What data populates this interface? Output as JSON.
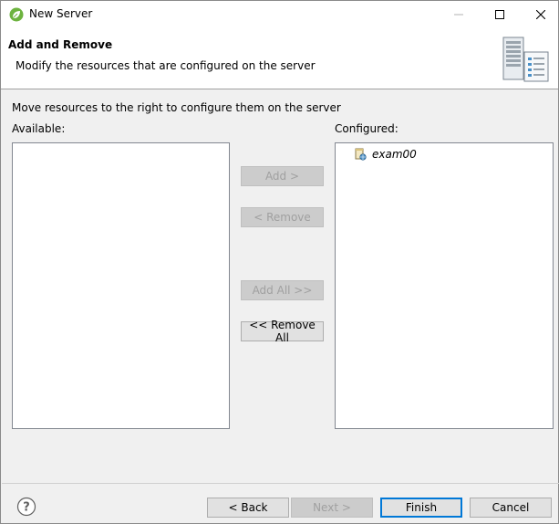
{
  "window": {
    "title": "New Server",
    "icon": "spring-leaf-icon"
  },
  "header": {
    "title": "Add and Remove",
    "description": "Modify the resources that are configured on the server",
    "graphic": "server-graphic-icon"
  },
  "main": {
    "instructions": "Move resources to the right to configure them on the server",
    "available_label": "Available:",
    "configured_label": "Configured:",
    "available_items": [],
    "configured_items": [
      {
        "label": "exam00",
        "icon": "web-module-icon"
      }
    ],
    "buttons": {
      "add": "Add >",
      "remove": "< Remove",
      "add_all": "Add All >>",
      "remove_all": "<< Remove All"
    }
  },
  "footer": {
    "back": "< Back",
    "next": "Next >",
    "finish": "Finish",
    "cancel": "Cancel"
  },
  "colors": {
    "accent": "#0078d7",
    "dialog_bg": "#f0f0f0",
    "button_bg": "#e1e1e1",
    "disabled_text": "#a0a0a0"
  }
}
